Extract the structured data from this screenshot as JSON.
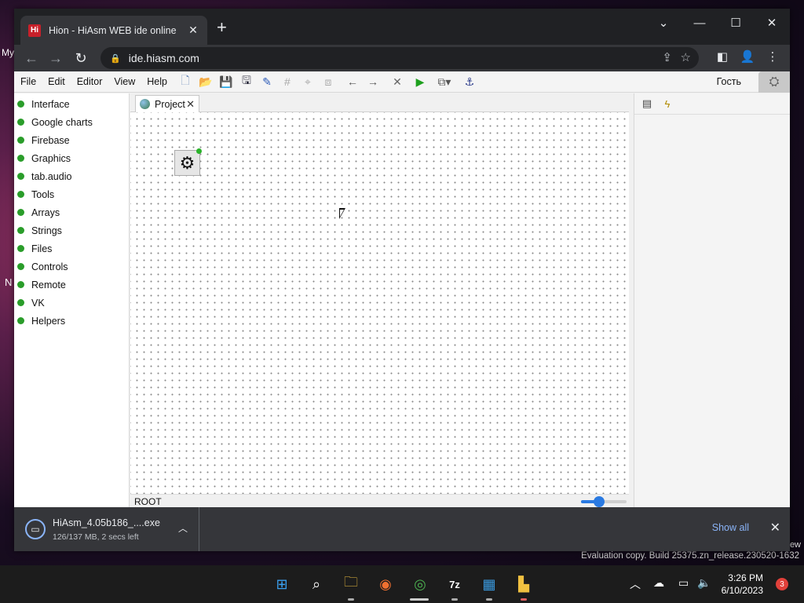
{
  "desktop": {
    "left_text": "My",
    "left_n": "N",
    "right_text": "ew",
    "watermark": "Evaluation copy. Build 25375.zn_release.230520-1632"
  },
  "browser": {
    "tab_title": "Hion - HiAsm WEB ide online",
    "favicon_glyph": "Hi",
    "url": "ide.hiasm.com"
  },
  "app": {
    "menu": [
      "File",
      "Edit",
      "Editor",
      "View",
      "Help"
    ],
    "user_label": "Гость",
    "categories": [
      "Interface",
      "Google charts",
      "Firebase",
      "Graphics",
      "tab.audio",
      "Tools",
      "Arrays",
      "Strings",
      "Files",
      "Controls",
      "Remote",
      "VK",
      "Helpers"
    ],
    "editor_tab": "Project",
    "status_path": "ROOT",
    "zoom_level": 0.4
  },
  "download": {
    "filename": "HiAsm_4.05b186_....exe",
    "status": "126/137 MB, 2 secs left",
    "show_all": "Show all"
  },
  "taskbar": {
    "time": "3:26 PM",
    "date": "6/10/2023",
    "notification_count": "3"
  },
  "colors": {
    "category_dot": "#2a9d2a",
    "accent": "#2a7ae2",
    "link": "#8ab4f8"
  }
}
